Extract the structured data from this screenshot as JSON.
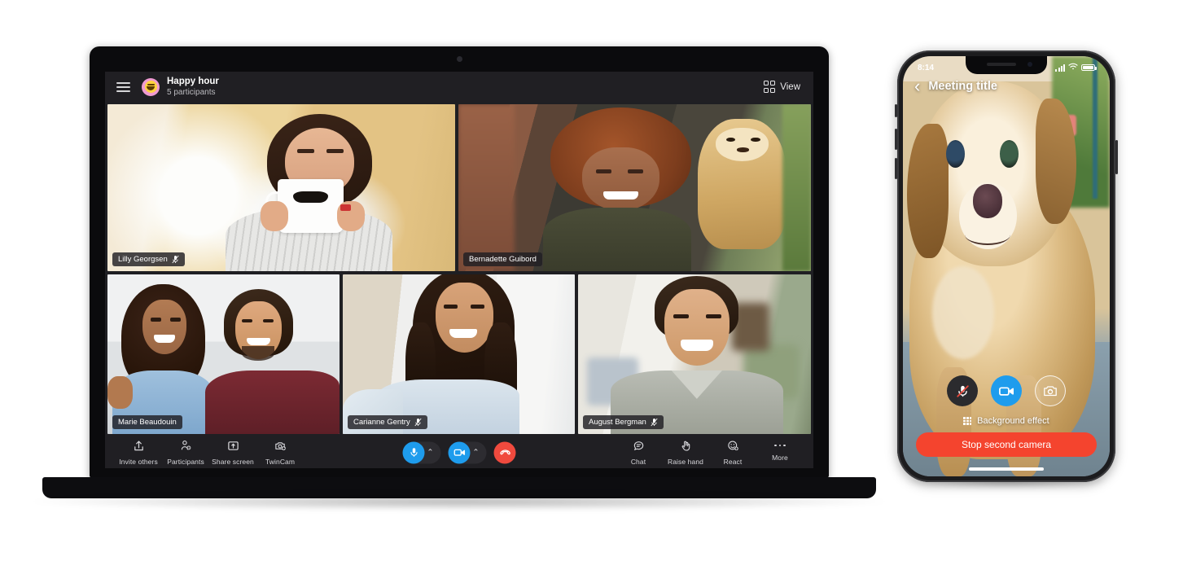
{
  "laptop": {
    "header": {
      "menu_icon": "hamburger-icon",
      "avatar_icon": "laughing-emoji-avatar",
      "meeting_title": "Happy hour",
      "participants_count": "5 participants",
      "view_label": "View",
      "view_icon": "grid-view-icon"
    },
    "tiles": [
      {
        "name": "Lilly Georgsen",
        "muted": true,
        "row": "top",
        "position": 1,
        "scene": "woman-with-mustache-mug",
        "bg": "#e6c786"
      },
      {
        "name": "Bernadette Guibord",
        "muted": false,
        "row": "top",
        "position": 2,
        "scene": "woman-with-dog",
        "bg": "#8a5c44"
      },
      {
        "name": "Marie Beaudouin",
        "muted": false,
        "row": "bottom",
        "position": 1,
        "scene": "couple-waving",
        "bg": "#cfd4d8"
      },
      {
        "name": "Carianne Gentry",
        "muted": true,
        "row": "bottom",
        "position": 2,
        "scene": "woman-selfie",
        "bg": "#e3e3e1"
      },
      {
        "name": "August Bergman",
        "muted": true,
        "row": "bottom",
        "position": 3,
        "scene": "man-selfie-cafe",
        "bg": "#d8d6cd"
      }
    ],
    "toolbar": {
      "left": [
        {
          "label": "Invite others",
          "icon": "share-upload-icon"
        },
        {
          "label": "Participants",
          "icon": "people-add-icon"
        },
        {
          "label": "Share screen",
          "icon": "screen-share-icon"
        },
        {
          "label": "TwinCam",
          "icon": "twin-camera-icon"
        }
      ],
      "center": {
        "mic": {
          "icon": "microphone-icon",
          "state": "on",
          "color": "#1e9ced"
        },
        "mic_chevron": "chevron-up-icon",
        "camera": {
          "icon": "video-camera-icon",
          "state": "on",
          "color": "#1e9ced"
        },
        "camera_chevron": "chevron-up-icon",
        "hangup": {
          "icon": "end-call-icon",
          "color": "#f04a3e"
        }
      },
      "right": [
        {
          "label": "Chat",
          "icon": "chat-bubble-icon"
        },
        {
          "label": "Raise hand",
          "icon": "raise-hand-icon"
        },
        {
          "label": "React",
          "icon": "react-emoji-icon"
        },
        {
          "label": "More",
          "icon": "more-ellipsis-icon"
        }
      ]
    }
  },
  "phone": {
    "status": {
      "time": "8:14",
      "signal_icon": "cellular-signal-icon",
      "wifi_icon": "wifi-icon",
      "battery_icon": "battery-full-icon"
    },
    "topbar": {
      "back_icon": "back-chevron-icon",
      "title": "Meeting title"
    },
    "video_scene": "golden-dog-outdoors",
    "controls": {
      "mic": {
        "icon": "microphone-muted-icon",
        "state": "muted",
        "color": "#2b2b2e"
      },
      "camera": {
        "icon": "video-camera-icon",
        "state": "on",
        "color": "#1e9ced"
      },
      "switch_camera": {
        "icon": "switch-camera-icon",
        "state": "outline"
      }
    },
    "background_effect": {
      "label": "Background effect",
      "icon": "background-effect-icon"
    },
    "stop_button": {
      "label": "Stop second camera",
      "color": "#f4442e"
    },
    "home_indicator": "home-indicator"
  }
}
